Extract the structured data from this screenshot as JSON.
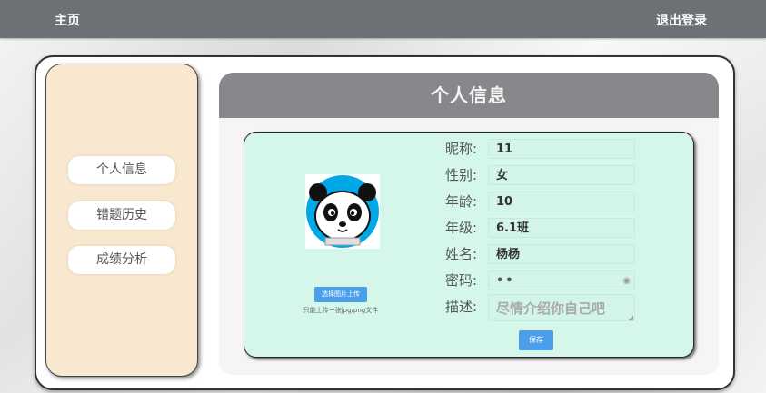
{
  "topbar": {
    "home": "主页",
    "logout": "退出登录"
  },
  "sidebar": {
    "items": [
      {
        "label": "个人信息"
      },
      {
        "label": "错题历史"
      },
      {
        "label": "成绩分析"
      }
    ]
  },
  "panel": {
    "title": "个人信息"
  },
  "avatar": {
    "icon": "panda-avatar",
    "bg_color": "#00a8e8"
  },
  "upload": {
    "button_label": "选择图片上传",
    "hint": "只能上传一张jpg/png文件"
  },
  "fields": [
    {
      "label": "昵称:",
      "value": "11"
    },
    {
      "label": "性别:",
      "value": "女"
    },
    {
      "label": "年龄:",
      "value": "10"
    },
    {
      "label": "年级:",
      "value": "6.1班"
    },
    {
      "label": "姓名:",
      "value": "杨杨"
    },
    {
      "label": "密码:",
      "value": "••"
    },
    {
      "label": "描述:",
      "placeholder": "尽情介绍你自己吧"
    }
  ],
  "save": {
    "label": "保存"
  },
  "colors": {
    "topbar": "#6d7075",
    "sidebar": "#f8e8cf",
    "form_card": "#d5f7ea",
    "accent": "#4a9fe8",
    "panel_header": "#87888b"
  }
}
